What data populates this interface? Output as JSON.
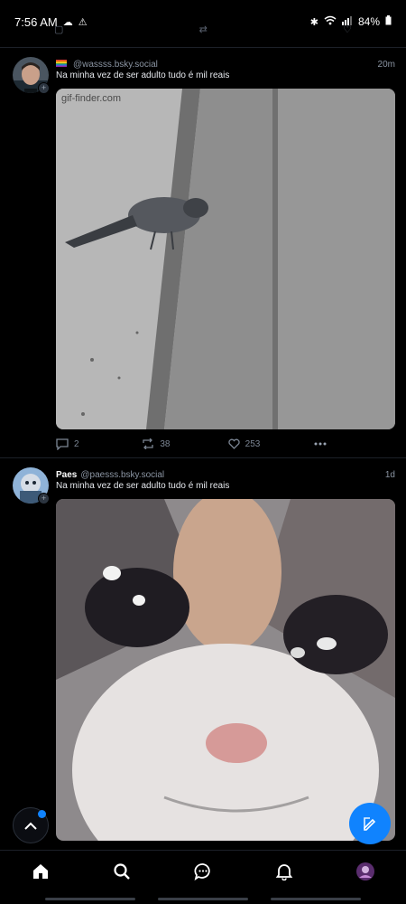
{
  "status_bar": {
    "time": "7:56 AM",
    "battery": "84%"
  },
  "feed": {
    "posts": [
      {
        "display_name": "",
        "handle": "@wassss.bsky.social",
        "time": "20m",
        "text": "Na minha vez de ser adulto tudo é mil reais",
        "media_icon": "gif-image",
        "media_watermark": "gif-finder.com",
        "replies": "2",
        "reposts": "38",
        "likes": "253"
      },
      {
        "display_name": "Paes",
        "handle": "@paesss.bsky.social",
        "time": "1d",
        "text": "Na minha vez de ser adulto tudo é mil reais",
        "media_icon": "crying-cat-gif"
      }
    ]
  },
  "bottom_nav": {
    "items": [
      {
        "name": "home",
        "icon": "home-icon"
      },
      {
        "name": "search",
        "icon": "search-icon"
      },
      {
        "name": "messages",
        "icon": "chat-icon"
      },
      {
        "name": "notifications",
        "icon": "bell-icon"
      },
      {
        "name": "profile",
        "icon": "avatar"
      }
    ]
  },
  "colors": {
    "accent": "#1083fe",
    "background": "#000000",
    "muted_text": "#8b95a3"
  }
}
